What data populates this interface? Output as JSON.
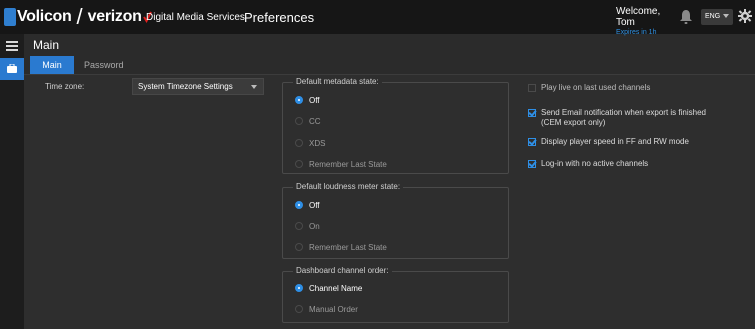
{
  "header": {
    "logo_text": "Volicon",
    "partner_text": "verizon",
    "brand_subtitle": "Digital Media Services",
    "page_title": "Preferences",
    "welcome": "Welcome, Tom",
    "expires": "Expires in 1h",
    "language": "ENG",
    "icons": [
      "bell-icon",
      "gear-icon",
      "chevron-down-icon"
    ]
  },
  "rail": {
    "icons": [
      "hamburger-icon",
      "briefcase-icon"
    ]
  },
  "section": {
    "title": "Main"
  },
  "tabs": [
    {
      "label": "Main",
      "active": true
    },
    {
      "label": "Password",
      "active": false
    }
  ],
  "timezone": {
    "label": "Time zone:",
    "value": "System Timezone Settings"
  },
  "metadata": {
    "legend": "Default metadata state:",
    "options": [
      {
        "label": "Off",
        "selected": true
      },
      {
        "label": "CC",
        "selected": false
      },
      {
        "label": "XDS",
        "selected": false
      },
      {
        "label": "Remember Last State",
        "selected": false
      }
    ]
  },
  "loudness": {
    "legend": "Default loudness meter state:",
    "options": [
      {
        "label": "Off",
        "selected": true
      },
      {
        "label": "On",
        "selected": false
      },
      {
        "label": "Remember Last State",
        "selected": false
      }
    ]
  },
  "channel_order": {
    "legend": "Dashboard channel order:",
    "options": [
      {
        "label": "Channel Name",
        "selected": true
      },
      {
        "label": "Manual Order",
        "selected": false
      }
    ]
  },
  "checkboxes": [
    {
      "label": "Play live on last used channels",
      "checked": false
    },
    {
      "label": "Send Email notification when export is finished (CEM export only)",
      "checked": true
    },
    {
      "label": "Display player speed in FF and RW mode",
      "checked": true
    },
    {
      "label": "Log-in with no active channels",
      "checked": true
    }
  ],
  "colors": {
    "accent": "#2a7ad0",
    "header_bg": "#161616",
    "content_bg": "#2e2e2e",
    "expires_text": "#2f8fe0"
  }
}
